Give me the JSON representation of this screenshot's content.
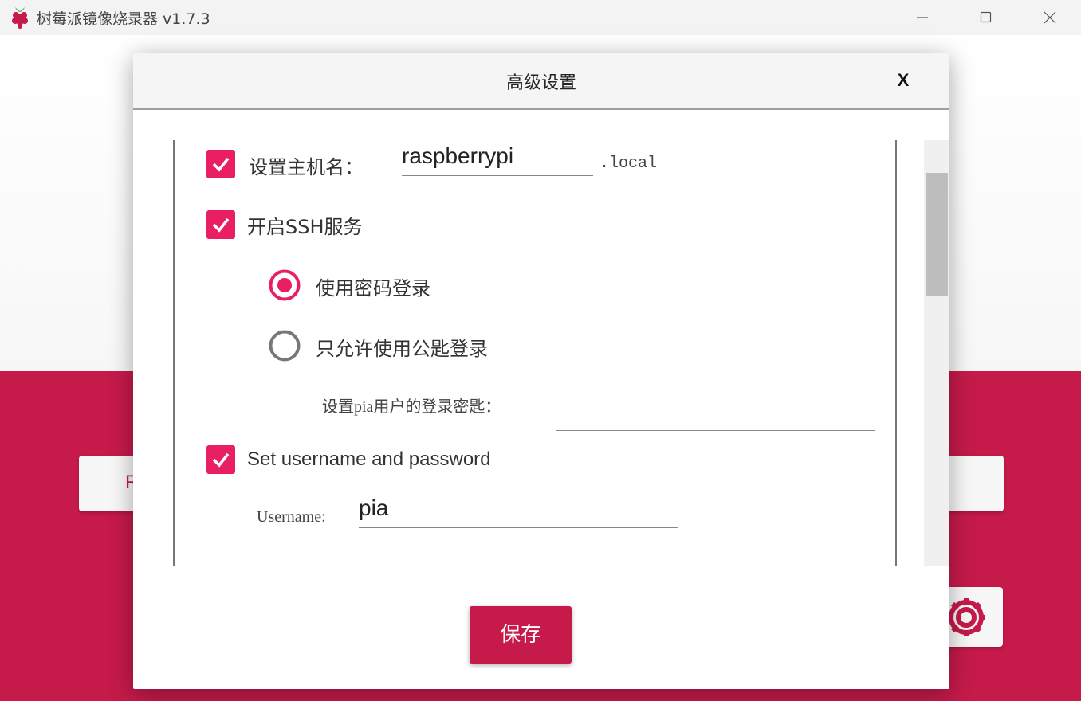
{
  "window": {
    "title": "树莓派镜像烧录器 v1.7.3",
    "icon": "raspberry-pi-logo"
  },
  "background": {
    "button_text": "R",
    "accent_color": "#c51a4a"
  },
  "dialog": {
    "title": "高级设置",
    "close_label": "X",
    "hostname": {
      "checked": true,
      "label": "设置主机名：",
      "value": "raspberrypi",
      "suffix": ".local"
    },
    "ssh": {
      "checked": true,
      "label": "开启SSH服务",
      "options": [
        {
          "label": "使用密码登录",
          "selected": true
        },
        {
          "label": "只允许使用公匙登录",
          "selected": false
        }
      ],
      "key_label": "设置pia用户的登录密匙：",
      "key_value": ""
    },
    "user": {
      "checked": true,
      "label": "Set username and password",
      "username_label": "Username:",
      "username_value": "pia"
    },
    "save_label": "保存"
  }
}
